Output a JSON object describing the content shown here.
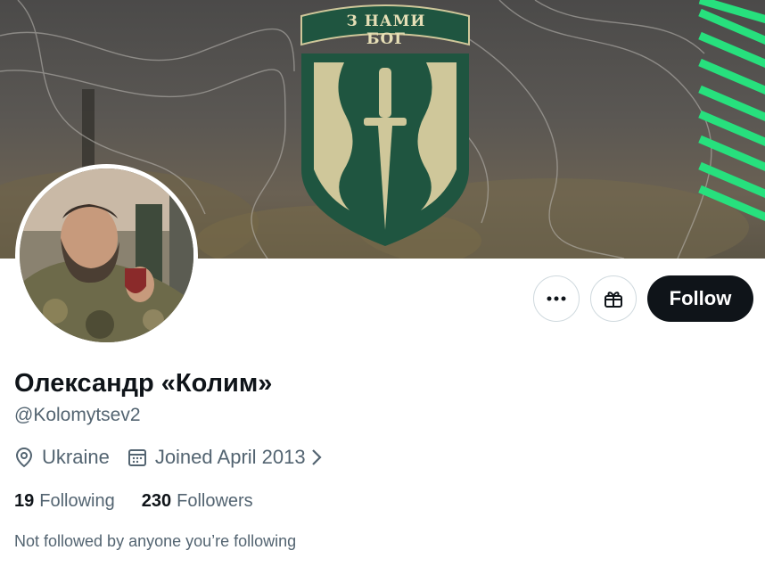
{
  "banner": {
    "patch_text": "З НАМИ БОГ",
    "patch_colors": {
      "field": "#1f5540",
      "stripe": "#cfc79a",
      "accent": "#27e07d"
    }
  },
  "profile": {
    "display_name": "Олександр «Колим»",
    "handle": "@Kolomytsev2",
    "location": "Ukraine",
    "joined": "Joined April 2013",
    "following_count": "19",
    "following_label": "Following",
    "followers_count": "230",
    "followers_label": "Followers",
    "not_followed_text": "Not followed by anyone you’re following"
  },
  "actions": {
    "more_icon": "more-icon",
    "gift_icon": "gift-icon",
    "follow_label": "Follow"
  },
  "colors": {
    "text_primary": "#0f1419",
    "text_secondary": "#536471",
    "button_dark": "#0f1419",
    "border": "#cfd9de"
  }
}
